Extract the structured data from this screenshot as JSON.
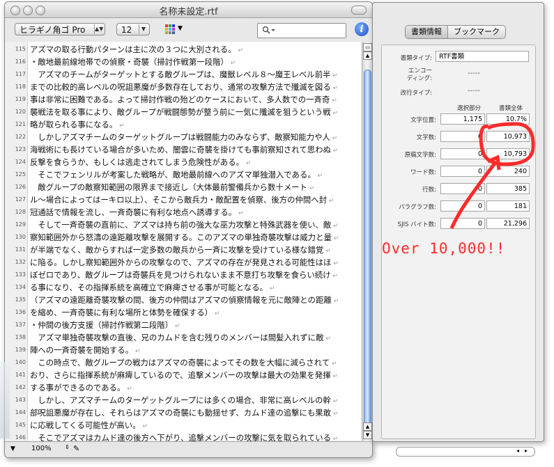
{
  "window": {
    "title": "名称未設定.rtf"
  },
  "toolbar": {
    "font_name": "ヒラギノ角ゴ Pro",
    "font_size": "12",
    "search_placeholder": ""
  },
  "editor": {
    "lines": [
      {
        "num": "115",
        "text": "アズマの取る行動パターンは主に次の３つに大別される。"
      },
      {
        "num": "116",
        "text": "・敵地最前線地帯での偵察・奇襲（掃討作戦第一段階）"
      },
      {
        "num": "117",
        "text": "　アズマのチームがターゲットとする敵グループは、魔獣レベル８〜魔王レベル前半"
      },
      {
        "num": "118",
        "text": "までの比較的高レベルの呪詛悪魔が多数存在しており、通常の攻撃方法で殲滅を図る"
      },
      {
        "num": "119",
        "text": "事は非常に困難である。よって掃討作戦の殆どのケースにおいて、多人数での一斉奇"
      },
      {
        "num": "120",
        "text": "襲戦法を取る事により、敵グループが戦闘態勢が整う前に一気に殲滅を狙うという戦"
      },
      {
        "num": "121",
        "text": "略が取られる事になる。"
      },
      {
        "num": "122",
        "text": "　しかしアズマチームのターゲットグループは戦闘能力のみならず、敵察知能力や人"
      },
      {
        "num": "123",
        "text": "海戦術にも長けている場合が多いため、闇雲に奇襲を掛けても事前察知されて思わぬ"
      },
      {
        "num": "124",
        "text": "反撃を食らうか、もしくは逃走されてしまう危険性がある。"
      },
      {
        "num": "125",
        "text": "　そこでフェンリルが考案した戦略が、敵地最前線へのアズマ単独潜入である。"
      },
      {
        "num": "126",
        "text": "　敵グループの敵察知範囲の限界まで接近し（大体最前警備兵から数十メート"
      },
      {
        "num": "127",
        "text": "ル〜場合によってはーキロ以上）、そこから敵兵力・敵配置を偵察、後方の仲間へ封"
      },
      {
        "num": "128",
        "text": "冠通話で情報を流し、一斉奇襲に有利な地点へ誘導する。"
      },
      {
        "num": "129",
        "text": "　そして一斉奇襲の直前に、アズマは持ち前の強大な巫力攻撃と特殊武器を使い、敵"
      },
      {
        "num": "130",
        "text": "察知範囲外から怒濤の遠距離攻撃を展開する。このアズマの単独奇襲攻撃は威力と量"
      },
      {
        "num": "131",
        "text": "が半端でなく、敵からすれば一定多数の敵兵から一斉に攻撃を受けている様な錯覚"
      },
      {
        "num": "132",
        "text": "に陥る。しかし察知範囲外からの攻撃なので、アズマの存在が発見される可能性はほ"
      },
      {
        "num": "133",
        "text": "ぼゼロであり、敵グループは奇襲兵を見つけられないまま不意打ち攻撃を食らい続け"
      },
      {
        "num": "134",
        "text": "る事になり、その指揮系統を高確立で麻痺させる事が可能となる。"
      },
      {
        "num": "135",
        "text": "（アズマの遠距離奇襲攻撃の間、後方の仲間はアズマの偵察情報を元に敵陣との距離"
      },
      {
        "num": "136",
        "text": "を縮め、一斉奇襲に有利な場所と体勢を確保する）"
      },
      {
        "num": "137",
        "text": "・仲間の後方支援（掃討作戦第二段階）"
      },
      {
        "num": "138",
        "text": "　アズマ単独奇襲攻撃の直後、兄のカムドを含む残りのメンバーは間髪入れずに敵"
      },
      {
        "num": "139",
        "text": "陣への一斉奇襲を開始する。"
      },
      {
        "num": "140",
        "text": "　この時点で、敵グループの戦力はアズマの奇襲によってその数を大幅に減らされて"
      },
      {
        "num": "141",
        "text": "おり、さらに指揮系統が麻痺しているので、追撃メンバーの攻撃は最大の効果を発揮"
      },
      {
        "num": "142",
        "text": "する事ができるのである。"
      },
      {
        "num": "143",
        "text": "　しかし、アズマチームのターゲットグループには多くの場合、非常に高レベルの幹"
      },
      {
        "num": "144",
        "text": "部呪詛悪魔が存在し、それらはアズマの奇襲にも動揺せず、カムド達の追撃にも果敢"
      },
      {
        "num": "145",
        "text": "に応戦してくる可能性が高い。"
      },
      {
        "num": "146",
        "text": "　そこでアズマはカムド達の後方へ下がり、追撃メンバーの攻撃に気を取られている"
      }
    ],
    "zoom": "100%"
  },
  "panel": {
    "tabs": [
      "書類情報",
      "ブックマーク"
    ],
    "doc_type_label": "書類タイプ:",
    "doc_type_value": "RTF書類",
    "encoding_label_1": "エンコー",
    "encoding_label_2": "ディング:",
    "encoding_value": "-----",
    "newline_label": "改行タイプ:",
    "newline_value": "-----",
    "col_selection": "選択部分",
    "col_whole": "書類全体",
    "rows": [
      {
        "label": "文字位置:",
        "selection": "1,175",
        "whole": "10.7%"
      },
      {
        "label": "文字数:",
        "selection": "0",
        "whole": "10,973"
      },
      {
        "label": "原稿文字数:",
        "selection": "0",
        "whole": "10,793"
      },
      {
        "label": "ワード数:",
        "selection": "0",
        "whole": "240"
      },
      {
        "label": "行数:",
        "selection": "0",
        "whole": "385"
      },
      {
        "label": "パラグラフ数:",
        "selection": "0",
        "whole": "181"
      },
      {
        "label": "SJIS バイト数:",
        "selection": "0",
        "whole": "21,296"
      }
    ]
  },
  "annotation": {
    "text": "Over 10,000!!",
    "color": "#ff2a2a"
  }
}
